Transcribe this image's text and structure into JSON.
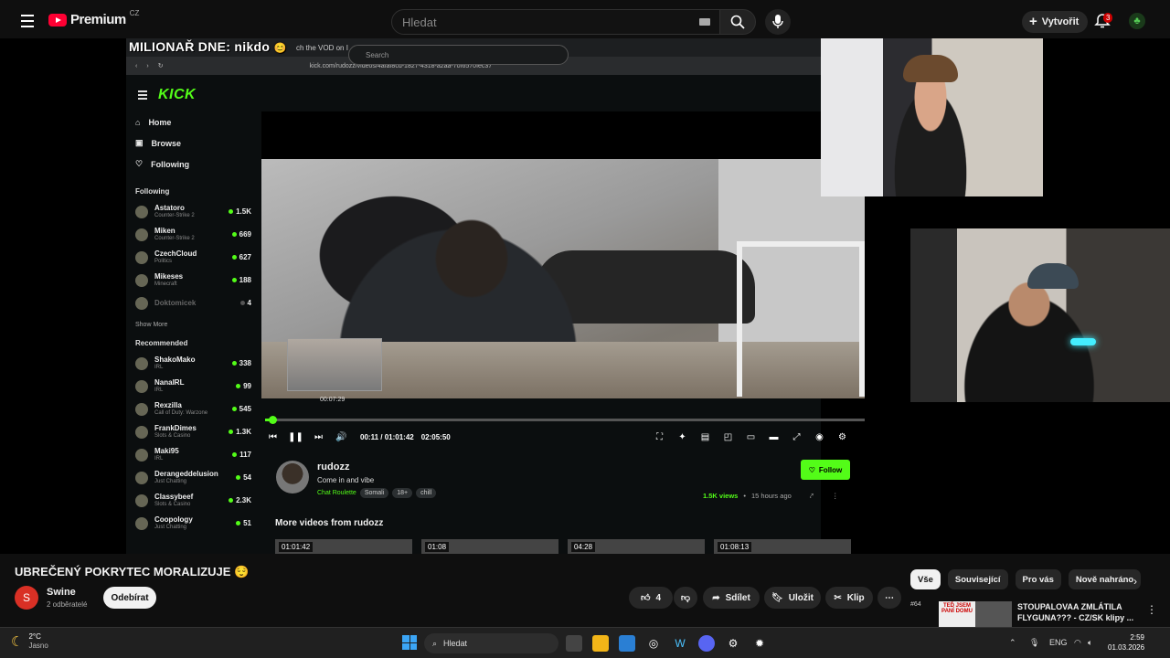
{
  "youtube": {
    "logo_text": "Premium",
    "country_code": "CZ",
    "search_placeholder": "Hledat",
    "create_label": "Vytvořit",
    "notifications_count": "3"
  },
  "stream_overlay": {
    "title": "MILIONAŘ DNE: nikdo"
  },
  "browser": {
    "tab_title": "ch the VOD on I",
    "address": "kick.com/rudozz/videos/4afaf8cd-1827-4318-a2aa-70f6570fec37"
  },
  "kick": {
    "logo": "KICK",
    "search_placeholder": "Search",
    "nav": [
      "Home",
      "Browse",
      "Following"
    ],
    "following_header": "Following",
    "following": [
      {
        "name": "Astatoro",
        "category": "Counter-Strike 2",
        "viewers": "1.5K"
      },
      {
        "name": "Miken",
        "category": "Counter-Strike 2",
        "viewers": "669"
      },
      {
        "name": "CzechCloud",
        "category": "Politics",
        "viewers": "627"
      },
      {
        "name": "Mikeses",
        "category": "Minecraft",
        "viewers": "188"
      },
      {
        "name": "Doktomicek",
        "category": "",
        "viewers": "4"
      }
    ],
    "show_more": "Show More",
    "recommended_header": "Recommended",
    "recommended": [
      {
        "name": "ShakoMako",
        "category": "IRL",
        "viewers": "338"
      },
      {
        "name": "NanaIRL",
        "category": "IRL",
        "viewers": "99"
      },
      {
        "name": "Rexzilla",
        "category": "Call of Duty: Warzone",
        "viewers": "545"
      },
      {
        "name": "FrankDimes",
        "category": "Slots & Casino",
        "viewers": "1.3K"
      },
      {
        "name": "Maki95",
        "category": "IRL",
        "viewers": "117"
      },
      {
        "name": "Derangeddelusion",
        "category": "Just Chatting",
        "viewers": "54"
      },
      {
        "name": "Classybeef",
        "category": "Slots & Casino",
        "viewers": "2.3K"
      },
      {
        "name": "Coopology",
        "category": "Just Chatting",
        "viewers": "51"
      }
    ],
    "player": {
      "hover_time": "00:07:29",
      "current_time": "00:11 / 01:01:42",
      "duration": "02:05:50",
      "progress": 0.012
    },
    "channel": {
      "name": "rudozz",
      "description": "Come in and vibe",
      "category": "Chat Roulette",
      "tags": [
        "Somali",
        "18+",
        "chill"
      ],
      "follow_label": "Follow",
      "views": "1.5K views",
      "ago": "15 hours ago"
    },
    "more_videos_title": "More videos from rudozz",
    "more_videos": [
      "01:01:42",
      "01:08",
      "04:28",
      "01:08:13"
    ]
  },
  "video": {
    "title": "UBREČENÝ POKRYTEC MORALIZUJE 😌",
    "channel_initial": "S",
    "channel_name": "Swine",
    "subscribers": "2 odběratelé",
    "subscribe_label": "Odebírat",
    "likes": "4",
    "share_label": "Sdílet",
    "save_label": "Uložit",
    "clip_label": "Klip"
  },
  "sidebar": {
    "chips": [
      "Vše",
      "Související",
      "Pro vás",
      "Nově nahráno"
    ],
    "rec_rank": "#64",
    "rec_thumb_text": "TEĎ JSEM PANÍ DOMU",
    "rec_title": "STOUPALOVAA ZMLÁTILA FLYGUNA??? - CZ/SK klipy ..."
  },
  "taskbar": {
    "temp": "2°C",
    "weather": "Jasno",
    "search_label": "Hledat",
    "lang": "ENG",
    "time": "2:59",
    "date": "01.03.2026"
  }
}
